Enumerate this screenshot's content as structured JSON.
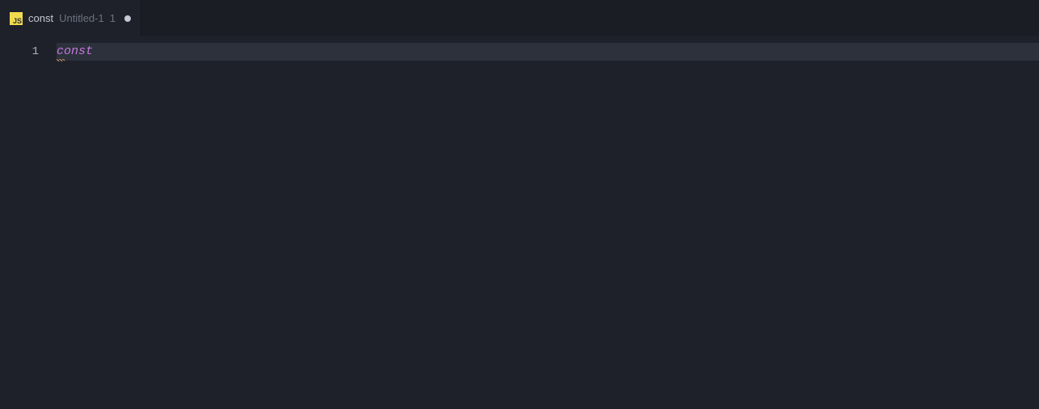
{
  "tab": {
    "icon_label": "JS",
    "title": "const",
    "subtitle": "Untitled-1",
    "index": "1",
    "dirty": true
  },
  "editor": {
    "lines": {
      "0": {
        "number": "1",
        "content": "const"
      }
    }
  }
}
